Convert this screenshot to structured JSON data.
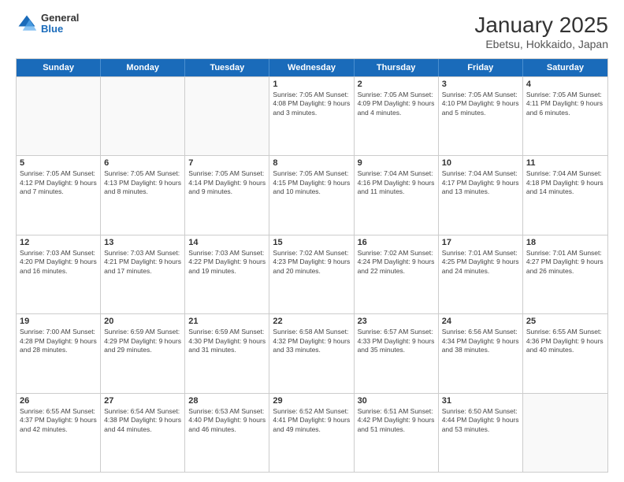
{
  "header": {
    "logo_general": "General",
    "logo_blue": "Blue",
    "title": "January 2025",
    "subtitle": "Ebetsu, Hokkaido, Japan"
  },
  "weekdays": [
    "Sunday",
    "Monday",
    "Tuesday",
    "Wednesday",
    "Thursday",
    "Friday",
    "Saturday"
  ],
  "weeks": [
    [
      {
        "day": "",
        "info": ""
      },
      {
        "day": "",
        "info": ""
      },
      {
        "day": "",
        "info": ""
      },
      {
        "day": "1",
        "info": "Sunrise: 7:05 AM\nSunset: 4:08 PM\nDaylight: 9 hours and 3 minutes."
      },
      {
        "day": "2",
        "info": "Sunrise: 7:05 AM\nSunset: 4:09 PM\nDaylight: 9 hours and 4 minutes."
      },
      {
        "day": "3",
        "info": "Sunrise: 7:05 AM\nSunset: 4:10 PM\nDaylight: 9 hours and 5 minutes."
      },
      {
        "day": "4",
        "info": "Sunrise: 7:05 AM\nSunset: 4:11 PM\nDaylight: 9 hours and 6 minutes."
      }
    ],
    [
      {
        "day": "5",
        "info": "Sunrise: 7:05 AM\nSunset: 4:12 PM\nDaylight: 9 hours and 7 minutes."
      },
      {
        "day": "6",
        "info": "Sunrise: 7:05 AM\nSunset: 4:13 PM\nDaylight: 9 hours and 8 minutes."
      },
      {
        "day": "7",
        "info": "Sunrise: 7:05 AM\nSunset: 4:14 PM\nDaylight: 9 hours and 9 minutes."
      },
      {
        "day": "8",
        "info": "Sunrise: 7:05 AM\nSunset: 4:15 PM\nDaylight: 9 hours and 10 minutes."
      },
      {
        "day": "9",
        "info": "Sunrise: 7:04 AM\nSunset: 4:16 PM\nDaylight: 9 hours and 11 minutes."
      },
      {
        "day": "10",
        "info": "Sunrise: 7:04 AM\nSunset: 4:17 PM\nDaylight: 9 hours and 13 minutes."
      },
      {
        "day": "11",
        "info": "Sunrise: 7:04 AM\nSunset: 4:18 PM\nDaylight: 9 hours and 14 minutes."
      }
    ],
    [
      {
        "day": "12",
        "info": "Sunrise: 7:03 AM\nSunset: 4:20 PM\nDaylight: 9 hours and 16 minutes."
      },
      {
        "day": "13",
        "info": "Sunrise: 7:03 AM\nSunset: 4:21 PM\nDaylight: 9 hours and 17 minutes."
      },
      {
        "day": "14",
        "info": "Sunrise: 7:03 AM\nSunset: 4:22 PM\nDaylight: 9 hours and 19 minutes."
      },
      {
        "day": "15",
        "info": "Sunrise: 7:02 AM\nSunset: 4:23 PM\nDaylight: 9 hours and 20 minutes."
      },
      {
        "day": "16",
        "info": "Sunrise: 7:02 AM\nSunset: 4:24 PM\nDaylight: 9 hours and 22 minutes."
      },
      {
        "day": "17",
        "info": "Sunrise: 7:01 AM\nSunset: 4:25 PM\nDaylight: 9 hours and 24 minutes."
      },
      {
        "day": "18",
        "info": "Sunrise: 7:01 AM\nSunset: 4:27 PM\nDaylight: 9 hours and 26 minutes."
      }
    ],
    [
      {
        "day": "19",
        "info": "Sunrise: 7:00 AM\nSunset: 4:28 PM\nDaylight: 9 hours and 28 minutes."
      },
      {
        "day": "20",
        "info": "Sunrise: 6:59 AM\nSunset: 4:29 PM\nDaylight: 9 hours and 29 minutes."
      },
      {
        "day": "21",
        "info": "Sunrise: 6:59 AM\nSunset: 4:30 PM\nDaylight: 9 hours and 31 minutes."
      },
      {
        "day": "22",
        "info": "Sunrise: 6:58 AM\nSunset: 4:32 PM\nDaylight: 9 hours and 33 minutes."
      },
      {
        "day": "23",
        "info": "Sunrise: 6:57 AM\nSunset: 4:33 PM\nDaylight: 9 hours and 35 minutes."
      },
      {
        "day": "24",
        "info": "Sunrise: 6:56 AM\nSunset: 4:34 PM\nDaylight: 9 hours and 38 minutes."
      },
      {
        "day": "25",
        "info": "Sunrise: 6:55 AM\nSunset: 4:36 PM\nDaylight: 9 hours and 40 minutes."
      }
    ],
    [
      {
        "day": "26",
        "info": "Sunrise: 6:55 AM\nSunset: 4:37 PM\nDaylight: 9 hours and 42 minutes."
      },
      {
        "day": "27",
        "info": "Sunrise: 6:54 AM\nSunset: 4:38 PM\nDaylight: 9 hours and 44 minutes."
      },
      {
        "day": "28",
        "info": "Sunrise: 6:53 AM\nSunset: 4:40 PM\nDaylight: 9 hours and 46 minutes."
      },
      {
        "day": "29",
        "info": "Sunrise: 6:52 AM\nSunset: 4:41 PM\nDaylight: 9 hours and 49 minutes."
      },
      {
        "day": "30",
        "info": "Sunrise: 6:51 AM\nSunset: 4:42 PM\nDaylight: 9 hours and 51 minutes."
      },
      {
        "day": "31",
        "info": "Sunrise: 6:50 AM\nSunset: 4:44 PM\nDaylight: 9 hours and 53 minutes."
      },
      {
        "day": "",
        "info": ""
      }
    ]
  ]
}
